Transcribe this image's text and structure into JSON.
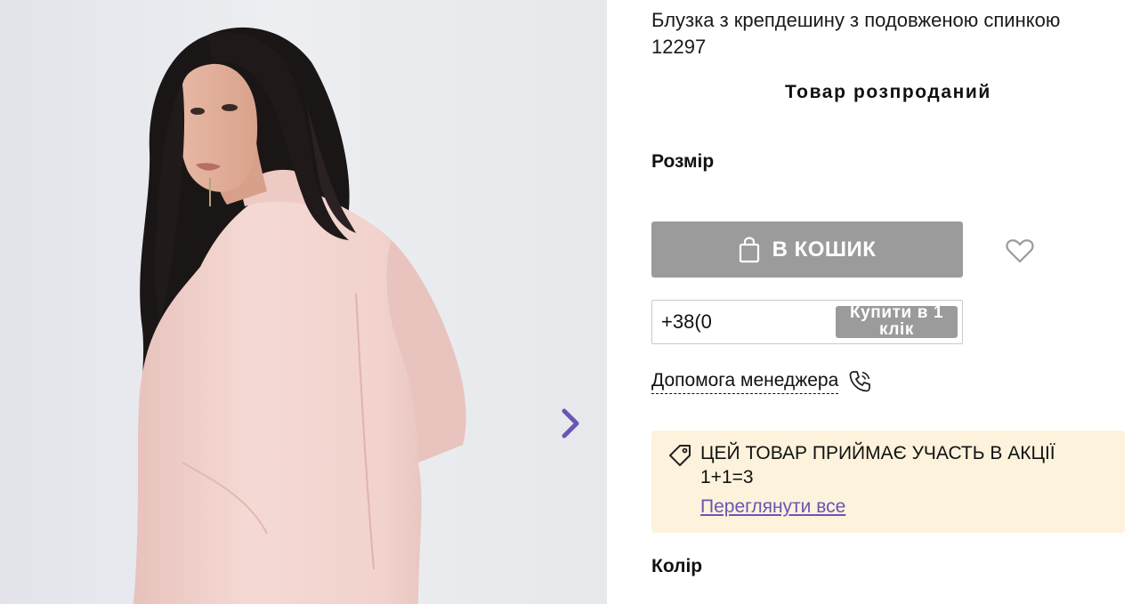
{
  "product": {
    "title": "Блузка з крепдешину з подовженою спинкою 12297",
    "availability": "Товар розпроданий",
    "size_label": "Розмір",
    "color_label": "Колір"
  },
  "cart": {
    "button_label": "В КОШИК",
    "icon": "shopping-bag-icon"
  },
  "wishlist": {
    "icon": "heart-icon"
  },
  "one_click": {
    "phone_value": "+38(0",
    "button_label": "Купити в 1 клік"
  },
  "manager_help": {
    "label": "Допомога менеджера",
    "icon": "phone-icon"
  },
  "promo": {
    "text": "ЦЕЙ ТОВАР ПРИЙМАЄ УЧАСТЬ В АКЦІЇ 1+1=3",
    "link_label": "Переглянути все",
    "icon": "tag-icon"
  },
  "gallery": {
    "next_icon": "chevron-right-icon"
  },
  "colors": {
    "disabled_button": "#9b9b9b",
    "promo_background": "#fdf2dc",
    "accent": "#6a55b3",
    "blouse": "#f2d3cf"
  }
}
